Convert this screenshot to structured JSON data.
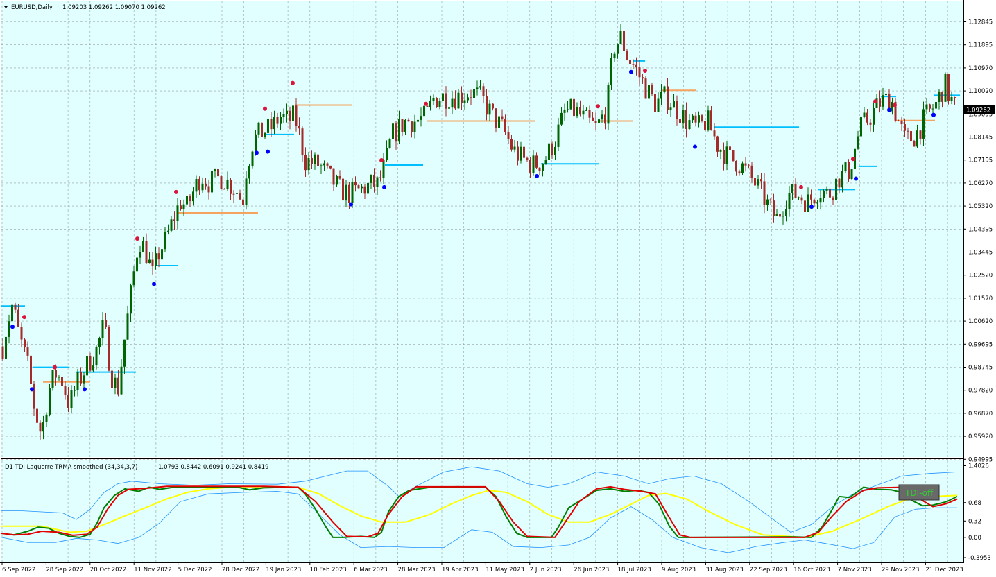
{
  "main": {
    "title": "EURUSD,Daily",
    "ohlc": "1.09203 1.09262 1.09070 1.09262",
    "current_price": "1.09262",
    "price_labels": [
      "1.12845",
      "1.11895",
      "1.10970",
      "1.10020",
      "1.09095",
      "1.08145",
      "1.07195",
      "1.06270",
      "1.05320",
      "1.04395",
      "1.03445",
      "1.02520",
      "1.01570",
      "1.00620",
      "0.99695",
      "0.98745",
      "0.97820",
      "0.96870",
      "0.95920",
      "0.94995"
    ]
  },
  "indicator": {
    "title": "D1 TDI Laguerre TRMA smoothed (34,34,3,7)",
    "values": "1.0793 0.8442 0.6091 0.9241 0.8419",
    "level_labels": [
      "1.4026",
      "0.68",
      "0.32",
      "0.00",
      "-0.3953"
    ],
    "badge": "TDI-off"
  },
  "time_labels": [
    "6 Sep 2022",
    "28 Sep 2022",
    "20 Oct 2022",
    "11 Nov 2022",
    "5 Dec 2022",
    "28 Dec 2022",
    "19 Jan 2023",
    "10 Feb 2023",
    "6 Mar 2023",
    "28 Mar 2023",
    "19 Apr 2023",
    "11 May 2023",
    "2 Jun 2023",
    "26 Jun 2023",
    "18 Jul 2023",
    "9 Aug 2023",
    "31 Aug 2023",
    "22 Sep 2023",
    "16 Oct 2023",
    "7 Nov 2023",
    "29 Nov 2023",
    "21 Dec 2023"
  ],
  "colors": {
    "background": "#e1ffff",
    "grid": "#96a0a0",
    "bull_candle": "#006400",
    "bear_candle": "#a52a2a",
    "tdi_green": "#008000",
    "tdi_red": "#e00000",
    "tdi_yellow": "#ffff00",
    "band_blue": "#1e90ff",
    "level_cyan": "#00bfff",
    "level_orange": "#f4a460",
    "dot_red": "#dc143c",
    "dot_blue": "#0000ff",
    "badge_bg": "#696969",
    "badge_text": "#32cd32"
  },
  "chart_data": {
    "type": "candlestick",
    "symbol": "EURUSD",
    "timeframe": "Daily",
    "ylim": [
      0.94995,
      1.12845
    ],
    "last_close": 1.09262,
    "close_path": [
      [
        0,
        0.99
      ],
      [
        10,
        1.005
      ],
      [
        18,
        1.013
      ],
      [
        28,
        1.0
      ],
      [
        40,
        0.988
      ],
      [
        50,
        0.97
      ],
      [
        60,
        0.96
      ],
      [
        70,
        0.978
      ],
      [
        80,
        0.985
      ],
      [
        90,
        0.982
      ],
      [
        100,
        0.972
      ],
      [
        110,
        0.98
      ],
      [
        125,
        0.988
      ],
      [
        140,
        0.995
      ],
      [
        150,
        1.005
      ],
      [
        160,
        0.985
      ],
      [
        170,
        0.978
      ],
      [
        180,
        1.0
      ],
      [
        190,
        1.02
      ],
      [
        200,
        1.04
      ],
      [
        210,
        1.035
      ],
      [
        220,
        1.025
      ],
      [
        230,
        1.035
      ],
      [
        240,
        1.04
      ],
      [
        250,
        1.048
      ],
      [
        260,
        1.055
      ],
      [
        270,
        1.053
      ],
      [
        280,
        1.06
      ],
      [
        290,
        1.066
      ],
      [
        300,
        1.063
      ],
      [
        320,
        1.065
      ],
      [
        340,
        1.06
      ],
      [
        350,
        1.055
      ],
      [
        355,
        1.068
      ],
      [
        365,
        1.08
      ],
      [
        375,
        1.083
      ],
      [
        390,
        1.085
      ],
      [
        405,
        1.09
      ],
      [
        415,
        1.088
      ],
      [
        425,
        1.09
      ],
      [
        432,
        1.082
      ],
      [
        440,
        1.072
      ],
      [
        460,
        1.07
      ],
      [
        475,
        1.065
      ],
      [
        490,
        1.06
      ],
      [
        505,
        1.058
      ],
      [
        520,
        1.06
      ],
      [
        535,
        1.062
      ],
      [
        545,
        1.062
      ],
      [
        555,
        1.07
      ],
      [
        565,
        1.082
      ],
      [
        575,
        1.085
      ],
      [
        585,
        1.088
      ],
      [
        600,
        1.088
      ],
      [
        615,
        1.09
      ],
      [
        625,
        1.097
      ],
      [
        640,
        1.098
      ],
      [
        660,
        1.098
      ],
      [
        680,
        1.1
      ],
      [
        695,
        1.097
      ],
      [
        710,
        1.09
      ],
      [
        725,
        1.085
      ],
      [
        740,
        1.076
      ],
      [
        755,
        1.072
      ],
      [
        770,
        1.07
      ],
      [
        785,
        1.072
      ],
      [
        800,
        1.08
      ],
      [
        815,
        1.092
      ],
      [
        830,
        1.092
      ],
      [
        845,
        1.088
      ],
      [
        860,
        1.085
      ],
      [
        875,
        1.093
      ],
      [
        885,
        1.118
      ],
      [
        895,
        1.122
      ],
      [
        905,
        1.114
      ],
      [
        915,
        1.11
      ],
      [
        930,
        1.102
      ],
      [
        945,
        1.095
      ],
      [
        960,
        1.098
      ],
      [
        975,
        1.093
      ],
      [
        990,
        1.088
      ],
      [
        1005,
        1.085
      ],
      [
        1020,
        1.088
      ],
      [
        1035,
        1.078
      ],
      [
        1050,
        1.073
      ],
      [
        1065,
        1.071
      ],
      [
        1080,
        1.066
      ],
      [
        1095,
        1.06
      ],
      [
        1110,
        1.052
      ],
      [
        1120,
        1.048
      ],
      [
        1135,
        1.058
      ],
      [
        1150,
        1.058
      ],
      [
        1165,
        1.055
      ],
      [
        1180,
        1.06
      ],
      [
        1195,
        1.058
      ],
      [
        1210,
        1.065
      ],
      [
        1225,
        1.068
      ],
      [
        1240,
        1.085
      ],
      [
        1255,
        1.09
      ],
      [
        1270,
        1.096
      ],
      [
        1285,
        1.097
      ],
      [
        1295,
        1.088
      ],
      [
        1305,
        1.08
      ],
      [
        1320,
        1.082
      ],
      [
        1335,
        1.09
      ],
      [
        1350,
        1.095
      ],
      [
        1362,
        1.103
      ],
      [
        1372,
        1.096
      ],
      [
        1380,
        1.0926
      ]
    ]
  }
}
